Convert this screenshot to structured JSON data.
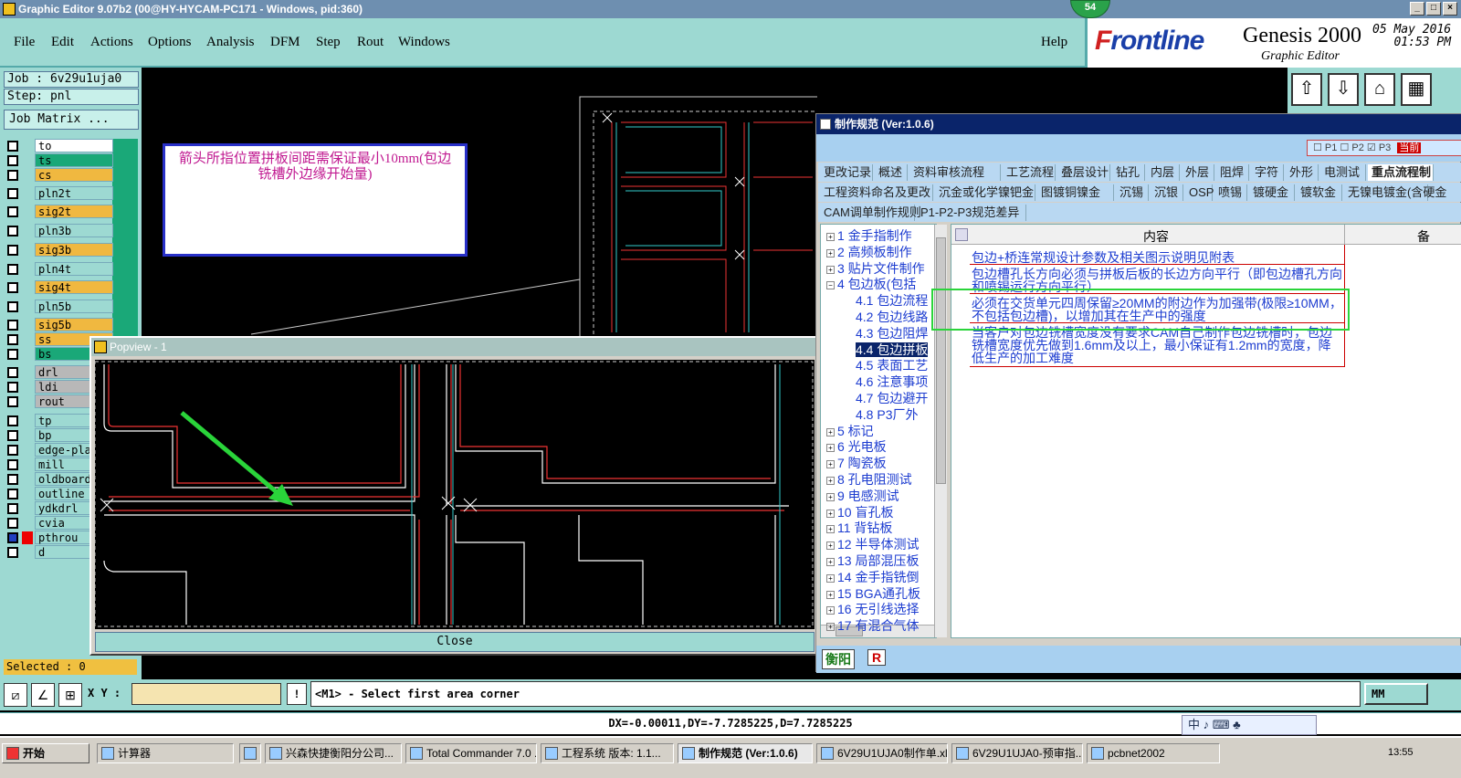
{
  "window": {
    "title": "Graphic Editor 9.07b2 (00@HY-HYCAM-PC171 - Windows, pid:360)",
    "badge": "54"
  },
  "menu": [
    "File",
    "Edit",
    "Actions",
    "Options",
    "Analysis",
    "DFM",
    "Step",
    "Rout",
    "Windows"
  ],
  "help": "Help",
  "brand": {
    "logo_prefix": "F",
    "logo_rest": "rontline",
    "product": "Genesis 2000",
    "subtitle": "Graphic Editor",
    "date": "05 May 2016",
    "time": "01:53 PM"
  },
  "job": {
    "job_label": "Job : 6v29u1uja0",
    "step_label": "Step: pnl",
    "matrix_button": "Job Matrix ..."
  },
  "layers": [
    {
      "name": "to",
      "color": "#ffffff"
    },
    {
      "name": "ts",
      "color": "#1aa878"
    },
    {
      "name": "cs",
      "color": "#f0b840"
    },
    {
      "name": "pln2t",
      "color": "#9dd9d2"
    },
    {
      "name": "sig2t",
      "color": "#f0b840"
    },
    {
      "name": "pln3b",
      "color": "#9dd9d2"
    },
    {
      "name": "sig3b",
      "color": "#f0b840"
    },
    {
      "name": "pln4t",
      "color": "#9dd9d2"
    },
    {
      "name": "sig4t",
      "color": "#f0b840"
    },
    {
      "name": "pln5b",
      "color": "#9dd9d2"
    },
    {
      "name": "sig5b",
      "color": "#f0b840"
    },
    {
      "name": "ss",
      "color": "#f0b840"
    },
    {
      "name": "bs",
      "color": "#1aa878"
    },
    {
      "name": "drl",
      "color": "#b8b8b8"
    },
    {
      "name": "ldi",
      "color": "#b8b8b8"
    },
    {
      "name": "rout",
      "color": "#b8b8b8"
    },
    {
      "name": "tp",
      "color": "#9dd9d2"
    },
    {
      "name": "bp",
      "color": "#9dd9d2"
    },
    {
      "name": "edge-pla",
      "color": "#9dd9d2"
    },
    {
      "name": "mill",
      "color": "#9dd9d2"
    },
    {
      "name": "oldboard",
      "color": "#9dd9d2"
    },
    {
      "name": "outline",
      "color": "#9dd9d2"
    },
    {
      "name": "ydkdrl",
      "color": "#9dd9d2"
    },
    {
      "name": "cvia",
      "color": "#9dd9d2"
    },
    {
      "name": "pthrou",
      "color": "#9dd9d2"
    },
    {
      "name": "d",
      "color": "#9dd9d2"
    }
  ],
  "annotation": "箭头所指位置拼板间距需保证最小10mm(包边铣槽外边缘开始量)",
  "popview": {
    "title": "Popview - 1",
    "close": "Close"
  },
  "spec": {
    "title": "制作规范 (Ver:1.0.6)",
    "pbox": [
      "P1",
      "P2",
      "P3",
      "当前"
    ],
    "tabs_row1": [
      "更改记录",
      "概述",
      "资料审核流程",
      "工艺流程",
      "叠层设计",
      "钻孔",
      "内层",
      "外层",
      "阻焊",
      "字符",
      "外形",
      "电测试",
      "重点流程制"
    ],
    "tabs_row2": [
      "工程资料命名及更改",
      "沉金或化学镍钯金",
      "图镀铜镍金",
      "沉锡",
      "沉银",
      "OSP",
      "喷锡",
      "镀硬金",
      "镀软金",
      "无镍电镀金(含硬金"
    ],
    "tabs_row3": [
      "CAM调单制作规则",
      "P1-P2-P3规范差异"
    ],
    "tree": [
      {
        "n": "1 金手指制作"
      },
      {
        "n": "2 高频板制作"
      },
      {
        "n": "3 贴片文件制作"
      },
      {
        "n": "4 包边板(包括"
      },
      {
        "n": "4.1 包边流程",
        "sub": true
      },
      {
        "n": "4.2 包边线路",
        "sub": true
      },
      {
        "n": "4.3 包边阻焊",
        "sub": true
      },
      {
        "n": "4.4 包边拼板",
        "sub": true,
        "hl": true
      },
      {
        "n": "4.5 表面工艺",
        "sub": true
      },
      {
        "n": "4.6 注意事项",
        "sub": true
      },
      {
        "n": "4.7 包边避开",
        "sub": true
      },
      {
        "n": "4.8 P3厂外",
        "sub": true
      },
      {
        "n": "5 标记"
      },
      {
        "n": "6 光电板"
      },
      {
        "n": "7 陶瓷板"
      },
      {
        "n": "8 孔电阻测试"
      },
      {
        "n": "9 电感测试"
      },
      {
        "n": "10 盲孔板"
      },
      {
        "n": "11 背钻板"
      },
      {
        "n": "12 半导体测试"
      },
      {
        "n": "13 局部混压板"
      },
      {
        "n": "14 金手指铣倒"
      },
      {
        "n": "15 BGA通孔板"
      },
      {
        "n": "16 无引线选择"
      },
      {
        "n": "17 有混合气体"
      }
    ],
    "col_content": "内容",
    "col_note": "备",
    "rows": [
      "包边+桥连常规设计参数及相关图示说明见附表",
      "包边槽孔长方向必须与拼板后板的长边方向平行（即包边槽孔方向和喷锡运行方向平行）",
      "必须在交货单元四周保留≥20MM的附边作为加强带(极限≥10MM，不包括包边槽)，以增加其在生产中的强度",
      "当客户对包边铣槽宽度没有要求CAM自己制作包边铣槽时，包边铣槽宽度优先做到1.6mm及以上，最小保证有1.2mm的宽度，降低生产的加工难度"
    ],
    "footer_left": "衡阳",
    "footer_r": "R"
  },
  "status": {
    "selected": "Selected : 0",
    "xy_label": "X Y :",
    "xy_value": "",
    "prompt": "<M1> - Select first area corner",
    "units": "MM",
    "dx": "DX=-0.00011,DY=-7.7285225,D=7.7285225"
  },
  "ime": "中 ♪ ⌨ ♣",
  "taskbar": {
    "start": "开始",
    "items": [
      "计算器",
      "",
      "兴森快捷衡阳分公司...",
      "Total Commander 7.0 ...",
      "工程系统  版本: 1.1...",
      "制作规范 (Ver:1.0.6)",
      "6V29U1UJA0制作单.xl...",
      "6V29U1UJA0-预审指...",
      "pcbnet2002"
    ],
    "clock": "13:55"
  },
  "colors": {
    "teal": "#9dd9d2",
    "yellow": "#f0b840",
    "green": "#1aa878",
    "title_blue": "#0a246a"
  }
}
